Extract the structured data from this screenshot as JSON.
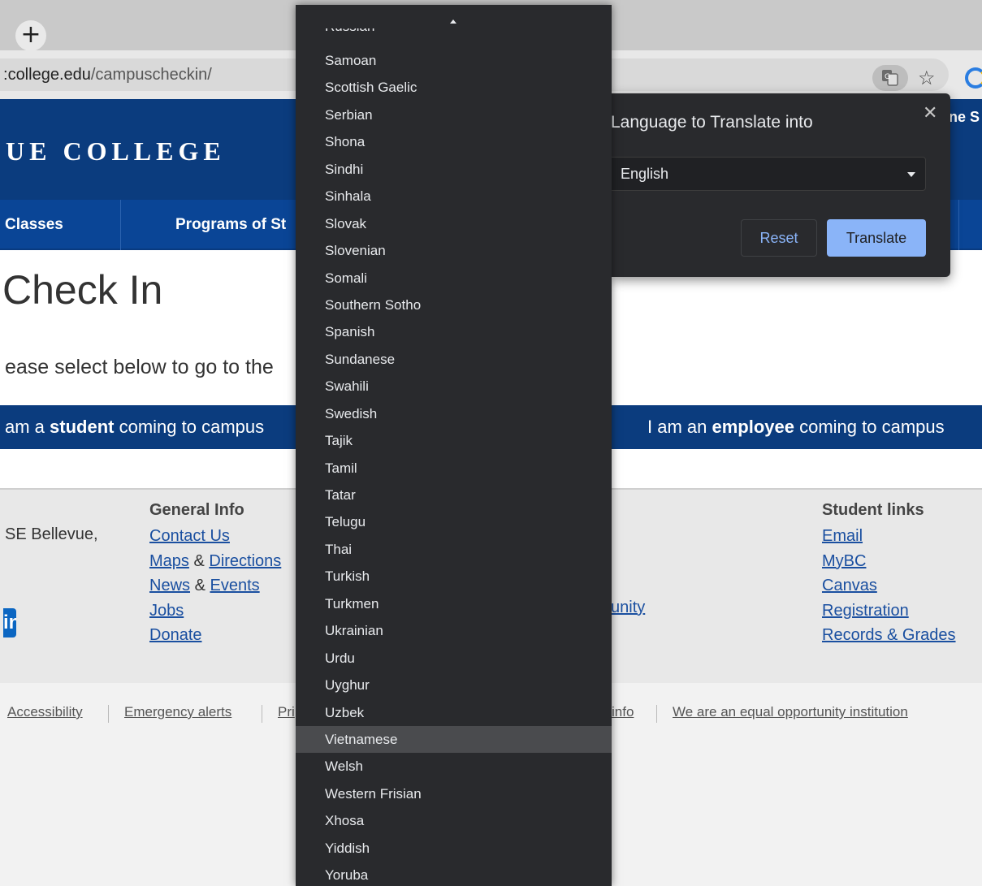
{
  "browser": {
    "new_tab_label": "+",
    "url_host": "college.edu",
    "url_host_prefix": ":",
    "url_path": "/campuscheckin/",
    "icons": [
      "translate-icon",
      "star-icon",
      "extension-icon"
    ]
  },
  "site": {
    "college_name": "UE COLLEGE",
    "header_util": "ne S",
    "nav": {
      "classes": "Classes",
      "programs": "Programs of St"
    },
    "page_title": "Check In",
    "instructions": "ease select below to go to the",
    "student_cta": {
      "pre": "am a ",
      "bold": "student",
      "post": " coming to campus"
    },
    "employee_cta": {
      "pre": "I am an ",
      "bold": "employee",
      "post": " coming to campus"
    }
  },
  "footer": {
    "address_fragment": "SE Bellevue,",
    "social_fragment": "in",
    "general_info": {
      "heading": "General Info",
      "contact": "Contact Us",
      "maps": "Maps",
      "directions": "Directions",
      "news": "News",
      "events": "Events",
      "jobs": "Jobs",
      "donate": "Donate",
      "amp": "&"
    },
    "mid_link": "unity",
    "student_links": {
      "heading": "Student links",
      "email": "Email",
      "mybc": "MyBC",
      "canvas": "Canvas",
      "registration": "Registration",
      "records": "Records & Grades"
    },
    "bottom": {
      "accessibility": "Accessibility",
      "emergency": "Emergency alerts",
      "privacy_fragment": "Pri",
      "info_fragment": "info",
      "equal_opportunity": "We are an equal opportunity institution"
    }
  },
  "translate_popup": {
    "title": "Language to Translate into",
    "close": "✕",
    "selected_language": "English",
    "reset_label": "Reset",
    "translate_label": "Translate",
    "accent_color": "#8ab4f8"
  },
  "language_list": {
    "partial_top_item": "Russian",
    "highlighted": "Vietnamese",
    "items": [
      "Samoan",
      "Scottish Gaelic",
      "Serbian",
      "Shona",
      "Sindhi",
      "Sinhala",
      "Slovak",
      "Slovenian",
      "Somali",
      "Southern Sotho",
      "Spanish",
      "Sundanese",
      "Swahili",
      "Swedish",
      "Tajik",
      "Tamil",
      "Tatar",
      "Telugu",
      "Thai",
      "Turkish",
      "Turkmen",
      "Ukrainian",
      "Urdu",
      "Uyghur",
      "Uzbek",
      "Vietnamese",
      "Welsh",
      "Western Frisian",
      "Xhosa",
      "Yiddish",
      "Yoruba"
    ]
  }
}
